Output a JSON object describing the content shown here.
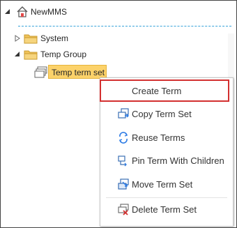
{
  "tree": {
    "root": {
      "label": "NewMMS",
      "icon": "home-tag-icon",
      "expander": "collapse-arrow-icon"
    },
    "groups": [
      {
        "label": "System",
        "icon": "folder-icon",
        "expander": "expand-arrow-icon"
      },
      {
        "label": "Temp Group",
        "icon": "folder-icon",
        "expander": "collapse-arrow-icon"
      }
    ],
    "term_set": {
      "label": "Temp term set",
      "icon": "term-set-icon"
    }
  },
  "context_menu": {
    "items": [
      {
        "label": "Create Term",
        "icon": "create-term-icon"
      },
      {
        "label": "Copy Term Set",
        "icon": "copy-term-set-icon"
      },
      {
        "label": "Reuse Terms",
        "icon": "reuse-terms-icon"
      },
      {
        "label": "Pin Term With Children",
        "icon": "pin-term-icon"
      },
      {
        "label": "Move Term Set",
        "icon": "move-term-set-icon"
      },
      {
        "label": "Delete Term Set",
        "icon": "delete-term-set-icon"
      }
    ]
  },
  "colors": {
    "selection": "#fcd26a",
    "highlight_border": "#d32f2f",
    "folder": "#f0c35a",
    "dotted_line": "#36a3d9"
  }
}
